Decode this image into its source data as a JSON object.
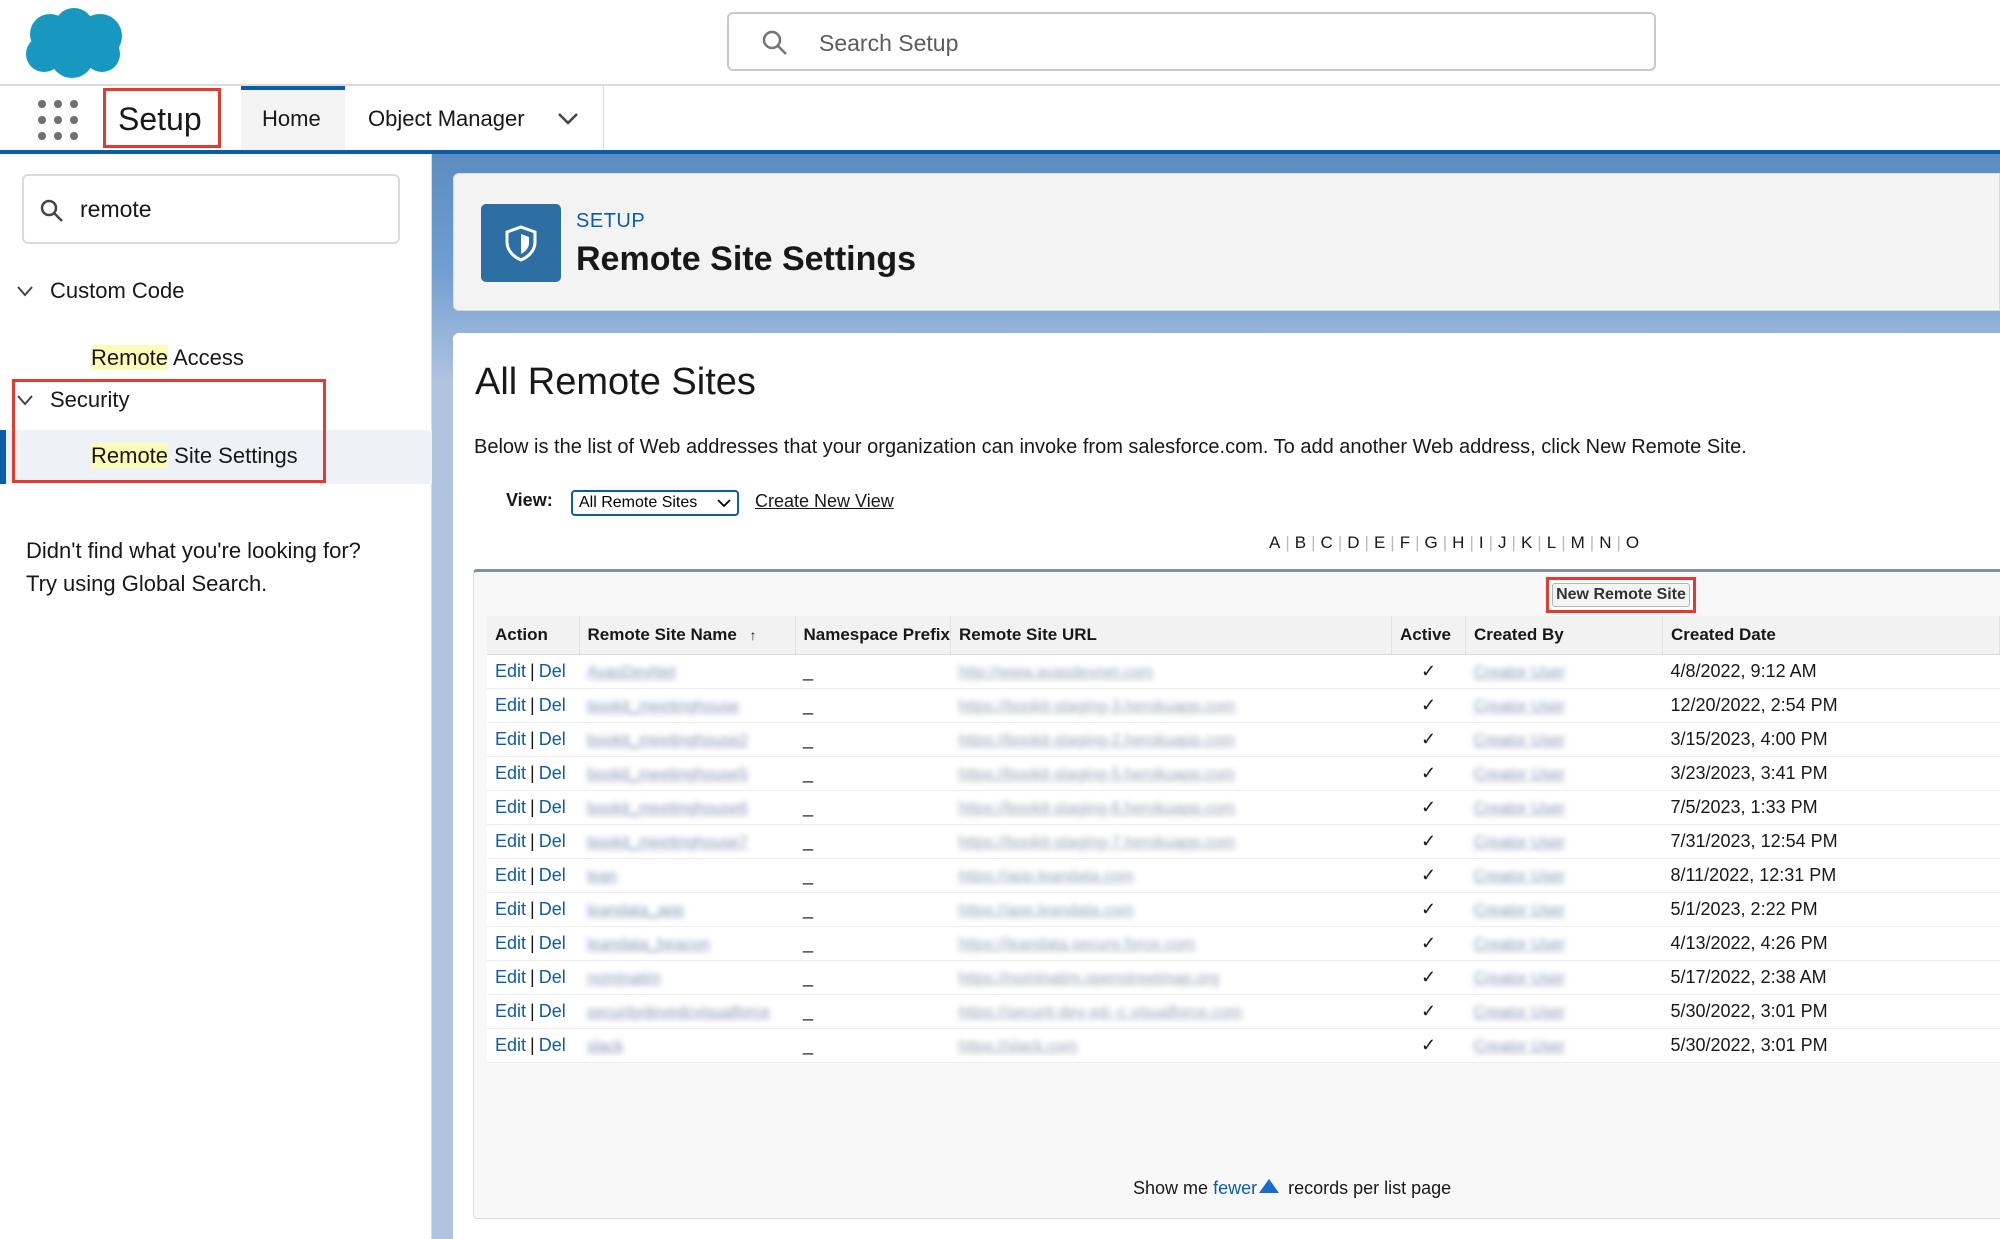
{
  "header": {
    "search_placeholder": "Search Setup"
  },
  "nav": {
    "app_label": "Setup",
    "tabs": [
      {
        "label": "Home"
      },
      {
        "label": "Object Manager"
      }
    ]
  },
  "sidebar": {
    "search_value": "remote",
    "groups": [
      {
        "label": "Custom Code",
        "items": [
          {
            "highlight": "Remote",
            "rest": " Access"
          }
        ]
      },
      {
        "label": "Security",
        "items": [
          {
            "highlight": "Remote",
            "rest": " Site Settings"
          }
        ]
      }
    ],
    "not_found_line1": "Didn't find what you're looking for?",
    "not_found_line2": "Try using Global Search."
  },
  "page_header": {
    "eyebrow": "SETUP",
    "title": "Remote Site Settings"
  },
  "content": {
    "title": "All Remote Sites",
    "description": "Below is the list of Web addresses that your organization can invoke from salesforce.com. To add another Web address, click New Remote Site.",
    "view_label": "View:",
    "view_selected": "All Remote Sites",
    "create_new_view": "Create New View",
    "alphabet": [
      "A",
      "B",
      "C",
      "D",
      "E",
      "F",
      "G",
      "H",
      "I",
      "J",
      "K",
      "L",
      "M",
      "N",
      "O"
    ],
    "new_button": "New Remote Site",
    "columns": [
      "Action",
      "Remote Site Name",
      "Namespace Prefix",
      "Remote Site URL",
      "Active",
      "Created By",
      "Created Date"
    ],
    "action_edit": "Edit",
    "action_del": "Del",
    "action_sep": "|",
    "sort_arrow": "↑",
    "rows": [
      {
        "name": "AvasDevNet",
        "ns": "_",
        "url": "http://www.avasdevnet.com",
        "active": "✓",
        "created_by": "Creator User",
        "date": "4/8/2022, 9:12 AM"
      },
      {
        "name": "bookit_meetinghouse",
        "ns": "_",
        "url": "https://bookit-staging-3.herokuapp.com",
        "active": "✓",
        "created_by": "Creator User",
        "date": "12/20/2022, 2:54 PM"
      },
      {
        "name": "bookit_meetinghouse2",
        "ns": "_",
        "url": "https://bookit-staging-2.herokuapp.com",
        "active": "✓",
        "created_by": "Creator User",
        "date": "3/15/2023, 4:00 PM"
      },
      {
        "name": "bookit_meetinghouse5",
        "ns": "_",
        "url": "https://bookit-staging-5.herokuapp.com",
        "active": "✓",
        "created_by": "Creator User",
        "date": "3/23/2023, 3:41 PM"
      },
      {
        "name": "bookit_meetinghouse6",
        "ns": "_",
        "url": "https://bookit-staging-6.herokuapp.com",
        "active": "✓",
        "created_by": "Creator User",
        "date": "7/5/2023, 1:33 PM"
      },
      {
        "name": "bookit_meetinghouse7",
        "ns": "_",
        "url": "https://bookit-staging-7.herokuapp.com",
        "active": "✓",
        "created_by": "Creator User",
        "date": "7/31/2023, 12:54 PM"
      },
      {
        "name": "lean",
        "ns": "_",
        "url": "https://app.leandata.com",
        "active": "✓",
        "created_by": "Creator User",
        "date": "8/11/2022, 12:31 PM"
      },
      {
        "name": "leandata_app",
        "ns": "_",
        "url": "https://app.leandata.com",
        "active": "✓",
        "created_by": "Creator User",
        "date": "5/1/2023, 2:22 PM"
      },
      {
        "name": "leandata_beacon",
        "ns": "_",
        "url": "https://leandata.secure.force.com",
        "active": "✓",
        "created_by": "Creator User",
        "date": "4/13/2022, 4:26 PM"
      },
      {
        "name": "nominatim",
        "ns": "_",
        "url": "https://nominatim.openstreetmap.org",
        "active": "✓",
        "created_by": "Creator User",
        "date": "5/17/2022, 2:38 AM"
      },
      {
        "name": "securitydevedcvisualforce",
        "ns": "_",
        "url": "https://securit-dev-ed--c.visualforce.com",
        "active": "✓",
        "created_by": "Creator User",
        "date": "5/30/2022, 3:01 PM"
      },
      {
        "name": "slack",
        "ns": "_",
        "url": "https://slack.com",
        "active": "✓",
        "created_by": "Creator User",
        "date": "5/30/2022, 3:01 PM"
      }
    ],
    "footer_prefix": "Show me",
    "footer_link": "fewer",
    "footer_suffix": "records per list page"
  }
}
